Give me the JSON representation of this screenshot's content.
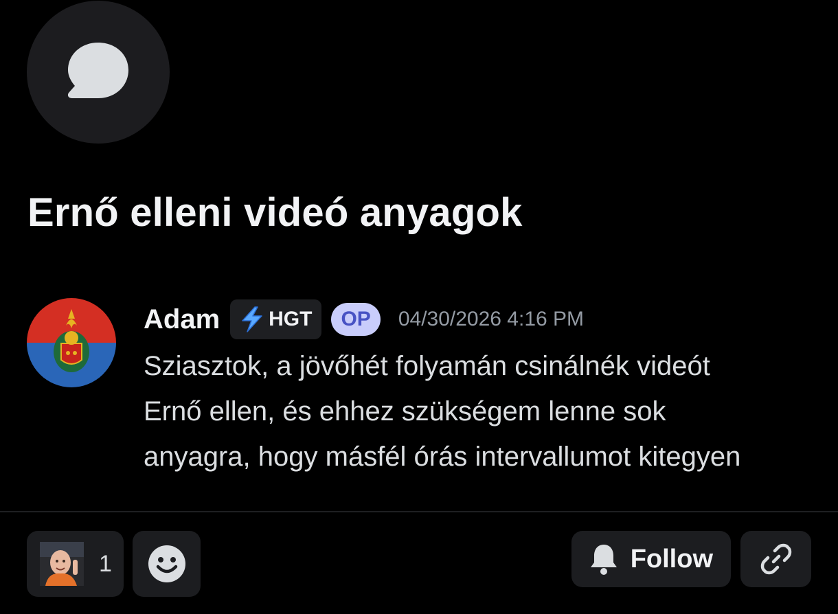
{
  "thread": {
    "icon": "chat-bubble-icon",
    "title": "Ernő elleni videó anyagok"
  },
  "message": {
    "avatar": "server-crest-avatar",
    "author": "Adam",
    "tag": {
      "icon": "lightning-icon",
      "text": "HGT"
    },
    "op_badge": "OP",
    "timestamp": "04/30/2026 4:16 PM",
    "body_lines": [
      "Sziasztok, a jövőhét folyamán csinálnék videót",
      "Ernő ellen, és ehhez szükségem lenne sok",
      "anyagra, hogy másfél órás intervallumot kitegyen"
    ]
  },
  "actions": {
    "reaction": {
      "icon": "user-photo-reaction",
      "count": "1"
    },
    "add_reaction_icon": "smiley-icon",
    "follow": {
      "icon": "bell-icon",
      "label": "Follow"
    },
    "copy_link_icon": "link-icon"
  },
  "colors": {
    "background": "#000000",
    "surface": "#1c1d20",
    "op_badge_bg": "#c9cdfb",
    "op_badge_text": "#4752c4",
    "timestamp": "#949ba4",
    "tag_accent": "#5aa9ff"
  }
}
